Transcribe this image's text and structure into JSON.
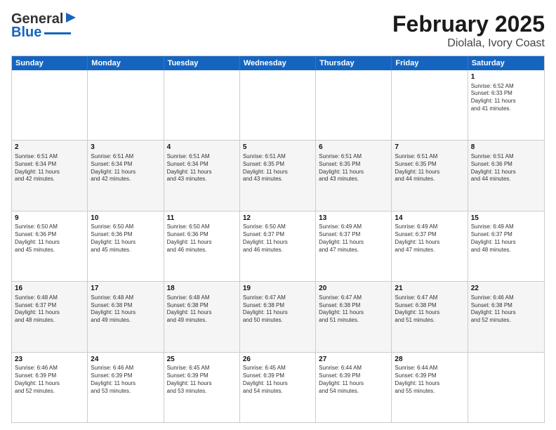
{
  "header": {
    "logo_line1": "General",
    "logo_line2": "Blue",
    "title": "February 2025",
    "subtitle": "Diolala, Ivory Coast"
  },
  "calendar": {
    "days": [
      "Sunday",
      "Monday",
      "Tuesday",
      "Wednesday",
      "Thursday",
      "Friday",
      "Saturday"
    ],
    "rows": [
      [
        {
          "day": "",
          "text": ""
        },
        {
          "day": "",
          "text": ""
        },
        {
          "day": "",
          "text": ""
        },
        {
          "day": "",
          "text": ""
        },
        {
          "day": "",
          "text": ""
        },
        {
          "day": "",
          "text": ""
        },
        {
          "day": "1",
          "text": "Sunrise: 6:52 AM\nSunset: 6:33 PM\nDaylight: 11 hours\nand 41 minutes."
        }
      ],
      [
        {
          "day": "2",
          "text": "Sunrise: 6:51 AM\nSunset: 6:34 PM\nDaylight: 11 hours\nand 42 minutes."
        },
        {
          "day": "3",
          "text": "Sunrise: 6:51 AM\nSunset: 6:34 PM\nDaylight: 11 hours\nand 42 minutes."
        },
        {
          "day": "4",
          "text": "Sunrise: 6:51 AM\nSunset: 6:34 PM\nDaylight: 11 hours\nand 43 minutes."
        },
        {
          "day": "5",
          "text": "Sunrise: 6:51 AM\nSunset: 6:35 PM\nDaylight: 11 hours\nand 43 minutes."
        },
        {
          "day": "6",
          "text": "Sunrise: 6:51 AM\nSunset: 6:35 PM\nDaylight: 11 hours\nand 43 minutes."
        },
        {
          "day": "7",
          "text": "Sunrise: 6:51 AM\nSunset: 6:35 PM\nDaylight: 11 hours\nand 44 minutes."
        },
        {
          "day": "8",
          "text": "Sunrise: 6:51 AM\nSunset: 6:36 PM\nDaylight: 11 hours\nand 44 minutes."
        }
      ],
      [
        {
          "day": "9",
          "text": "Sunrise: 6:50 AM\nSunset: 6:36 PM\nDaylight: 11 hours\nand 45 minutes."
        },
        {
          "day": "10",
          "text": "Sunrise: 6:50 AM\nSunset: 6:36 PM\nDaylight: 11 hours\nand 45 minutes."
        },
        {
          "day": "11",
          "text": "Sunrise: 6:50 AM\nSunset: 6:36 PM\nDaylight: 11 hours\nand 46 minutes."
        },
        {
          "day": "12",
          "text": "Sunrise: 6:50 AM\nSunset: 6:37 PM\nDaylight: 11 hours\nand 46 minutes."
        },
        {
          "day": "13",
          "text": "Sunrise: 6:49 AM\nSunset: 6:37 PM\nDaylight: 11 hours\nand 47 minutes."
        },
        {
          "day": "14",
          "text": "Sunrise: 6:49 AM\nSunset: 6:37 PM\nDaylight: 11 hours\nand 47 minutes."
        },
        {
          "day": "15",
          "text": "Sunrise: 6:49 AM\nSunset: 6:37 PM\nDaylight: 11 hours\nand 48 minutes."
        }
      ],
      [
        {
          "day": "16",
          "text": "Sunrise: 6:48 AM\nSunset: 6:37 PM\nDaylight: 11 hours\nand 48 minutes."
        },
        {
          "day": "17",
          "text": "Sunrise: 6:48 AM\nSunset: 6:38 PM\nDaylight: 11 hours\nand 49 minutes."
        },
        {
          "day": "18",
          "text": "Sunrise: 6:48 AM\nSunset: 6:38 PM\nDaylight: 11 hours\nand 49 minutes."
        },
        {
          "day": "19",
          "text": "Sunrise: 6:47 AM\nSunset: 6:38 PM\nDaylight: 11 hours\nand 50 minutes."
        },
        {
          "day": "20",
          "text": "Sunrise: 6:47 AM\nSunset: 6:38 PM\nDaylight: 11 hours\nand 51 minutes."
        },
        {
          "day": "21",
          "text": "Sunrise: 6:47 AM\nSunset: 6:38 PM\nDaylight: 11 hours\nand 51 minutes."
        },
        {
          "day": "22",
          "text": "Sunrise: 6:46 AM\nSunset: 6:38 PM\nDaylight: 11 hours\nand 52 minutes."
        }
      ],
      [
        {
          "day": "23",
          "text": "Sunrise: 6:46 AM\nSunset: 6:39 PM\nDaylight: 11 hours\nand 52 minutes."
        },
        {
          "day": "24",
          "text": "Sunrise: 6:46 AM\nSunset: 6:39 PM\nDaylight: 11 hours\nand 53 minutes."
        },
        {
          "day": "25",
          "text": "Sunrise: 6:45 AM\nSunset: 6:39 PM\nDaylight: 11 hours\nand 53 minutes."
        },
        {
          "day": "26",
          "text": "Sunrise: 6:45 AM\nSunset: 6:39 PM\nDaylight: 11 hours\nand 54 minutes."
        },
        {
          "day": "27",
          "text": "Sunrise: 6:44 AM\nSunset: 6:39 PM\nDaylight: 11 hours\nand 54 minutes."
        },
        {
          "day": "28",
          "text": "Sunrise: 6:44 AM\nSunset: 6:39 PM\nDaylight: 11 hours\nand 55 minutes."
        },
        {
          "day": "",
          "text": ""
        }
      ]
    ]
  }
}
